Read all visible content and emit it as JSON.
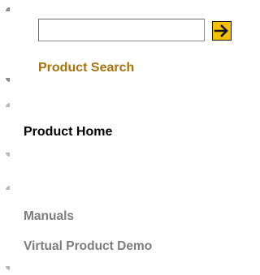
{
  "search": {
    "value": "",
    "placeholder": "",
    "go_icon": "arrow-right-icon",
    "accent_color": "#f5c000"
  },
  "links": {
    "product_search": "Product Search",
    "product_home": "Product Home",
    "manuals": "Manuals",
    "virtual_product_demo": "Virtual Product Demo"
  },
  "colors": {
    "search_link": "#a8720c",
    "active_link": "#000000",
    "inactive_link": "#7d7d7d"
  }
}
